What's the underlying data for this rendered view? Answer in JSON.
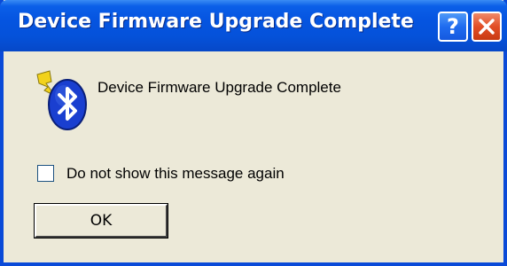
{
  "window": {
    "title": "Device Firmware Upgrade Complete",
    "help_label": "?",
    "close_icon": "close-icon"
  },
  "content": {
    "icon": "bluetooth-icon",
    "message": "Device Firmware Upgrade Complete"
  },
  "checkbox": {
    "label": "Do not show this message again",
    "checked": false
  },
  "buttons": {
    "ok_label": "OK"
  },
  "colors": {
    "titlebar": "#0554e0",
    "window_bg": "#ece9d8",
    "close_button": "#e24e26",
    "bluetooth_blue": "#1a3fd0",
    "lightning": "#f2d21c"
  }
}
